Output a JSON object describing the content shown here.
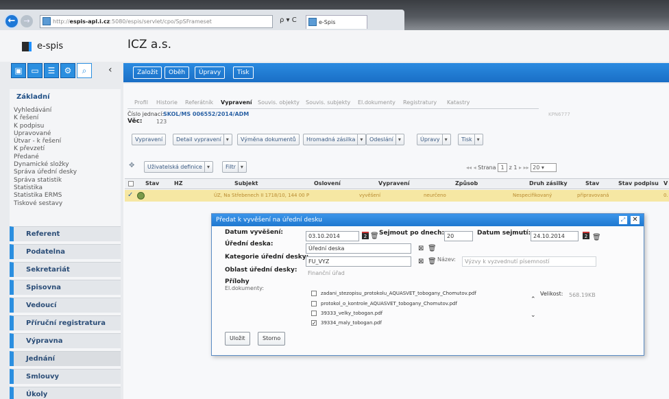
{
  "browser": {
    "url_scheme": "http://",
    "url_host": "espis-apl.i.cz",
    "url_path": ":5080/espis/servlet/cpo/SpSFrameset",
    "tab_title": "e-Spis",
    "address_tools": "ρ ▾ C"
  },
  "app": {
    "logo_text": "e-spis",
    "org_title": "ICZ a.s."
  },
  "toolbar": {
    "buttons": [
      "Založit",
      "Oběh",
      "Úpravy",
      "Tisk"
    ]
  },
  "sidebar": {
    "section_title": "Základní",
    "items": [
      "Vyhledávání",
      "K řešení",
      "K podpisu",
      "Upravované",
      "Útvar - k řešení",
      "K převzetí",
      "Předané",
      "Dynamické složky",
      "Správa úřední desky",
      "Správa statistik",
      "Statistika",
      "Statistika ERMS",
      "Tiskové sestavy"
    ],
    "groups": [
      "Referent",
      "Podatelna",
      "Sekretariát",
      "Spisovna",
      "Vedoucí",
      "Příruční registratura",
      "Výpravna",
      "Jednání",
      "Smlouvy",
      "Úkoly"
    ]
  },
  "document": {
    "tabs": [
      "Profil",
      "Historie",
      "Referátník",
      "Vypravení",
      "Souvis. objekty",
      "Souvis. subjekty",
      "El.dokumenty",
      "Registratury",
      "Katastry"
    ],
    "active_tab": "Vypravení",
    "ref_label": "Číslo jednací:",
    "ref_value": "SKOL/MS 006552/2014/ADM",
    "vec_label": "Věc:",
    "vec_value": "123",
    "faded_code": "KPN6777",
    "actions": [
      "Vypravení",
      "Detail vypravení",
      "Výměna dokumentů",
      "Hromadná zásilka",
      "Odeslání",
      "Úpravy",
      "Tisk"
    ]
  },
  "grid": {
    "user_definition": "Uživatelská definice",
    "filter": "Filtr",
    "pager_label": "Strana",
    "pager_page": "1",
    "pager_of": "z 1",
    "pager_size": "20",
    "columns": [
      "Stav",
      "HZ",
      "Subjekt",
      "Oslovení",
      "Vypravení",
      "Způsob",
      "Druh zásilky",
      "Stav",
      "Stav podpisu",
      "V"
    ],
    "row": {
      "subjekt": "ÚZ, Na Střebenech II 1718/10, 144 00 P",
      "vypraveni": "vyvěšení",
      "zpusob": "neurčeno",
      "druh": "Nespecifikovaný",
      "stav": "připravovaná",
      "extra": "0."
    }
  },
  "modal": {
    "title": "Předat k vyvěšení na úřední desku",
    "datum_vyveseni_label": "Datum vyvěšení:",
    "datum_vyveseni_value": "03.10.2014",
    "sejmout_label": "Sejmout po dnech:",
    "sejmout_value": "20",
    "datum_sejmuti_label": "Datum sejmutí:",
    "datum_sejmuti_value": "24.10.2014",
    "uredni_deska_label": "Úřední deska:",
    "uredni_deska_value": "Úřední deska",
    "kategorie_label": "Kategorie úřední desky:",
    "kategorie_value": "FU_VYZ",
    "nazev_label": "Název:",
    "nazev_value": "Výzvy k vyzvednutí písemností",
    "oblast_label": "Oblast úřední desky:",
    "oblast_value": "Finanční úřad",
    "prilohy_label": "Přílohy",
    "el_dokumenty_label": "El.dokumenty:",
    "documents": [
      {
        "name": "zadani_stezopisu_protokolu_AQUASVET_tobogany_Chomutov.pdf",
        "checked": false
      },
      {
        "name": "protokol_o_kontrole_AQUASVET_tobogany_Chomutov.pdf",
        "checked": false
      },
      {
        "name": "39333_velky_tobogan.pdf",
        "checked": false
      },
      {
        "name": "39334_maly_tobogan.pdf",
        "checked": true
      }
    ],
    "velikost_label": "Velikost:",
    "velikost_value": "568.19KB",
    "save_label": "Uložit",
    "cancel_label": "Storno"
  }
}
